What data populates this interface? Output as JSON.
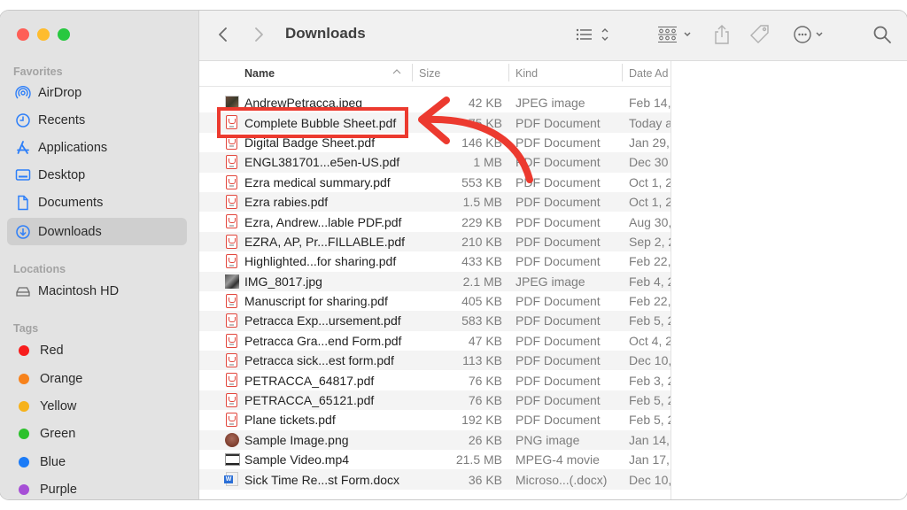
{
  "window": {
    "title": "Downloads",
    "traffic_lights": [
      {
        "name": "close",
        "color": "#fe5f57"
      },
      {
        "name": "minimize",
        "color": "#febc2e"
      },
      {
        "name": "zoom",
        "color": "#28c840"
      }
    ]
  },
  "sidebar": {
    "sections": {
      "favorites": "Favorites",
      "locations": "Locations",
      "tags": "Tags"
    },
    "favorites": [
      {
        "label": "AirDrop",
        "icon": "airdrop-icon"
      },
      {
        "label": "Recents",
        "icon": "clock-icon"
      },
      {
        "label": "Applications",
        "icon": "applications-icon"
      },
      {
        "label": "Desktop",
        "icon": "desktop-icon"
      },
      {
        "label": "Documents",
        "icon": "document-icon"
      },
      {
        "label": "Downloads",
        "icon": "download-icon",
        "active": true
      }
    ],
    "locations": [
      {
        "label": "Macintosh HD",
        "icon": "hard-drive-icon"
      }
    ],
    "tags": [
      {
        "label": "Red",
        "color": "#f71d1d"
      },
      {
        "label": "Orange",
        "color": "#f7821b"
      },
      {
        "label": "Yellow",
        "color": "#f6b21b"
      },
      {
        "label": "Green",
        "color": "#2cc12c"
      },
      {
        "label": "Blue",
        "color": "#1b7bf7"
      },
      {
        "label": "Purple",
        "color": "#a64fd6"
      }
    ]
  },
  "toolbar": {
    "back": "back-icon",
    "forward": "forward-icon",
    "view_mode": "list-view-icon",
    "group": "group-icon",
    "share": "share-icon",
    "tag": "tag-icon",
    "more": "more-icon",
    "search": "search-icon"
  },
  "columns": {
    "name": "Name",
    "size": "Size",
    "kind": "Kind",
    "date": "Date Ad"
  },
  "files": [
    {
      "name": "AndrewPetracca.jpeg",
      "size": "42 KB",
      "kind": "JPEG image",
      "date": "Feb 14,",
      "icon": "jpg"
    },
    {
      "name": "Complete Bubble Sheet.pdf",
      "size": "75 KB",
      "kind": "PDF Document",
      "date": "Today a",
      "icon": "pdf",
      "highlighted": true
    },
    {
      "name": "Digital Badge Sheet.pdf",
      "size": "146 KB",
      "kind": "PDF Document",
      "date": "Jan 29,",
      "icon": "pdf"
    },
    {
      "name": "ENGL381701...e5en-US.pdf",
      "size": "1 MB",
      "kind": "PDF Document",
      "date": "Dec 30",
      "icon": "pdf"
    },
    {
      "name": "Ezra medical summary.pdf",
      "size": "553 KB",
      "kind": "PDF Document",
      "date": "Oct 1, 2",
      "icon": "pdf"
    },
    {
      "name": "Ezra rabies.pdf",
      "size": "1.5 MB",
      "kind": "PDF Document",
      "date": "Oct 1, 2",
      "icon": "pdf"
    },
    {
      "name": "Ezra, Andrew...lable PDF.pdf",
      "size": "229 KB",
      "kind": "PDF Document",
      "date": "Aug 30,",
      "icon": "pdf"
    },
    {
      "name": "EZRA, AP, Pr...FILLABLE.pdf",
      "size": "210 KB",
      "kind": "PDF Document",
      "date": "Sep 2, 2",
      "icon": "pdf"
    },
    {
      "name": "Highlighted...for sharing.pdf",
      "size": "433 KB",
      "kind": "PDF Document",
      "date": "Feb 22,",
      "icon": "pdf"
    },
    {
      "name": "IMG_8017.jpg",
      "size": "2.1 MB",
      "kind": "JPEG image",
      "date": "Feb 4, 2",
      "icon": "jpg2"
    },
    {
      "name": "Manuscript for sharing.pdf",
      "size": "405 KB",
      "kind": "PDF Document",
      "date": "Feb 22,",
      "icon": "pdf"
    },
    {
      "name": "Petracca Exp...ursement.pdf",
      "size": "583 KB",
      "kind": "PDF Document",
      "date": "Feb 5, 2",
      "icon": "pdf"
    },
    {
      "name": "Petracca Gra...end Form.pdf",
      "size": "47 KB",
      "kind": "PDF Document",
      "date": "Oct 4, 2",
      "icon": "pdf"
    },
    {
      "name": "Petracca sick...est form.pdf",
      "size": "113 KB",
      "kind": "PDF Document",
      "date": "Dec 10,",
      "icon": "pdf"
    },
    {
      "name": "PETRACCA_64817.pdf",
      "size": "76 KB",
      "kind": "PDF Document",
      "date": "Feb 3, 2",
      "icon": "pdf"
    },
    {
      "name": "PETRACCA_65121.pdf",
      "size": "76 KB",
      "kind": "PDF Document",
      "date": "Feb 5, 2",
      "icon": "pdf"
    },
    {
      "name": "Plane tickets.pdf",
      "size": "192 KB",
      "kind": "PDF Document",
      "date": "Feb 5, 2",
      "icon": "pdf"
    },
    {
      "name": "Sample Image.png",
      "size": "26 KB",
      "kind": "PNG image",
      "date": "Jan 14,",
      "icon": "png"
    },
    {
      "name": "Sample Video.mp4",
      "size": "21.5 MB",
      "kind": "MPEG-4 movie",
      "date": "Jan 17,",
      "icon": "mp4"
    },
    {
      "name": "Sick Time Re...st Form.docx",
      "size": "36 KB",
      "kind": "Microso...(.docx)",
      "date": "Dec 10,",
      "icon": "docx"
    }
  ],
  "annotation": {
    "color": "#ec3a2f",
    "target": "Complete Bubble Sheet.pdf"
  }
}
